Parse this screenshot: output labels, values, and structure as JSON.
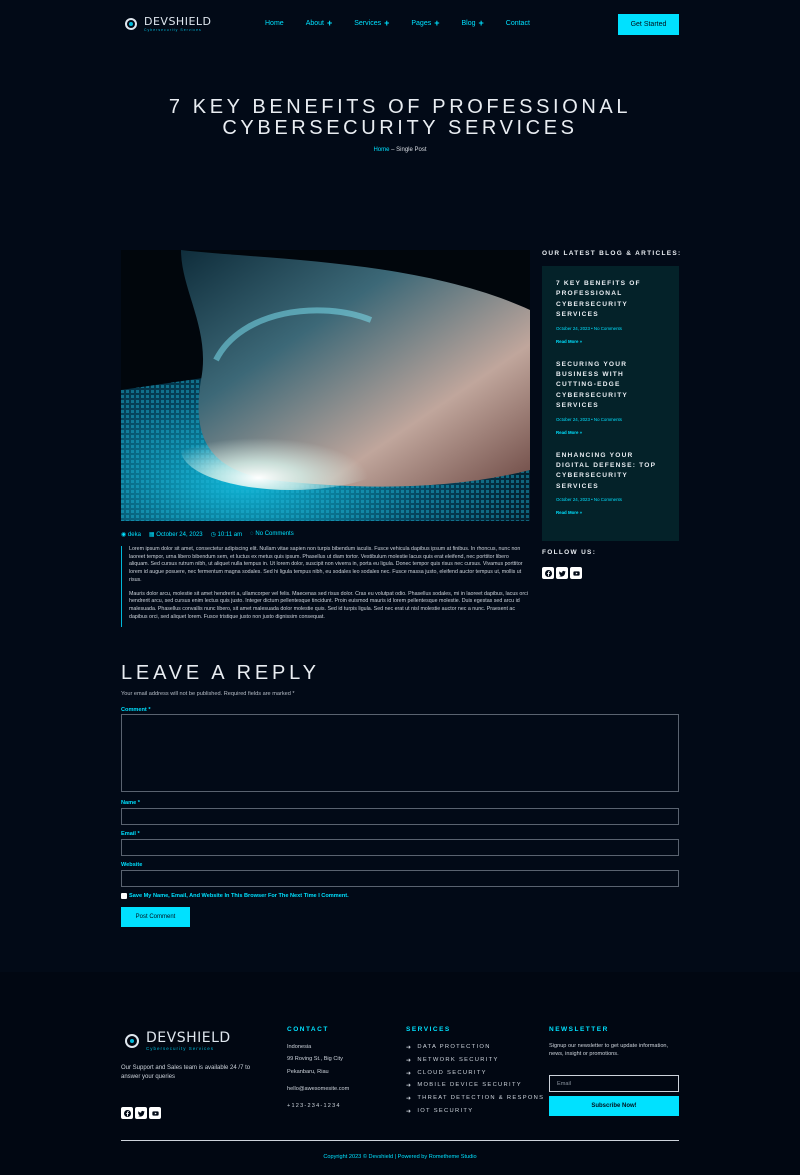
{
  "header": {
    "logo_text": "DEVSHIELD",
    "logo_sub": "Cybersecurity Services",
    "menu": [
      {
        "label": "Home",
        "plus": ""
      },
      {
        "label": "About",
        "plus": "+"
      },
      {
        "label": "Services",
        "plus": "+"
      },
      {
        "label": "Pages",
        "plus": "+"
      },
      {
        "label": "Blog",
        "plus": "+"
      },
      {
        "label": "Contact",
        "plus": ""
      }
    ],
    "cta": "Get Started"
  },
  "hero": {
    "title_line1": "7 KEY BENEFITS OF PROFESSIONAL",
    "title_line2": "CYBERSECURITY SERVICES",
    "crumb_home": "Home",
    "crumb_sep": " – ",
    "crumb_current": "Single Post"
  },
  "post": {
    "author": "deka",
    "date": "October 24, 2023",
    "time": "10:11 am",
    "comments": "No Comments",
    "paragraph1": "Lorem ipsum dolor sit amet, consectetur adipiscing elit. Nullam vitae sapien non turpis bibendum iaculis. Fusce vehicula dapibus ipsum at finibus. In rhoncus, nunc non laoreet tempor, urna libero bibendum sem, et luctus ex metus quis ipsum. Phasellus ut diam tortor. Vestibulum molestie lacus quis erat eleifend, nec porttitor libero aliquam. Sed cursus rutrum nibh, ut aliquet nulla tempus in. Ut lorem dolor, suscipit non viverra in, porta eu ligula. Donec tempor quis risus nec cursus. Vivamus porttitor lorem id augue posuere, nec fermentum magna sodales. Sed hi ligula tempus nibh, eu sodales leo sodales nec. Fusce massa justo, eleifend auctor tempus ut, mollis ut risus.",
    "paragraph2": "Mauris dolor arcu, molestie sit amet hendrerit a, ullamcorper vel felis. Maecenas sed risus dolor. Cras eu volutpat odio. Phasellus sodales, mi in laoreet dapibus, lacus orci hendrerit arcu, sed cursus enim lectus quis justo. Integer dictum pellentesque tincidunt. Proin euismod mauris id lorem pellentesque molestie. Duis egestas sed arcu id malesuada. Phasellus convallis nunc libero, sit amet malesuada dolor molestie quis. Sed id turpis ligula. Sed nec erat ut nisl molestie auctor nec a nunc. Praesent ac dapibus orci, sed aliquet lorem. Fusce tristique justo non justo dignissim consequat."
  },
  "sidebar": {
    "heading": "OUR LATEST BLOG & ARTICLES:",
    "posts": [
      {
        "title": "7 KEY BENEFITS OF PROFESSIONAL CYBERSECURITY SERVICES",
        "meta": "October 24, 2023 • No Comments",
        "more": "Read More »"
      },
      {
        "title": "SECURING YOUR BUSINESS WITH CUTTING-EDGE CYBERSECURITY SERVICES",
        "meta": "October 24, 2023 • No Comments",
        "more": "Read More »"
      },
      {
        "title": "ENHANCING YOUR DIGITAL DEFENSE: TOP CYBERSECURITY SERVICES",
        "meta": "October 24, 2023 • No Comments",
        "more": "Read More »"
      }
    ],
    "follow": "FOLLOW US:"
  },
  "reply": {
    "title": "LEAVE A REPLY",
    "note": "Your email address will not be published. Required fields are marked *",
    "comment_label": "Comment *",
    "name_label": "Name *",
    "email_label": "Email *",
    "website_label": "Website",
    "save_label": "Save My Name, Email, And Website In This Browser For The Next Time I Comment.",
    "submit": "Post Comment"
  },
  "footer": {
    "logo_text": "DEVSHIELD",
    "logo_sub": "Cybersecurity Services",
    "about": "Our Support and Sales team is available 24 /7 to answer your queries",
    "contact_heading": "CONTACT",
    "contact_country": "Indonesia",
    "contact_street": "99 Roving St., Big City",
    "contact_city": "Pekanbaru, Riau",
    "contact_email": "hello@awesomesite.com",
    "contact_phone": "+123-234-1234",
    "services_heading": "SERVICES",
    "services": [
      "DATA PROTECTION",
      "NETWORK SECURITY",
      "CLOUD SECURITY",
      "MOBILE DEVICE SECURITY",
      "THREAT DETECTION & RESPONS",
      "IOT SECURITY"
    ],
    "newsletter_heading": "NEWSLETTER",
    "newsletter_text": "Signup our newsletter to get update information, news, insight or promotions.",
    "email_placeholder": "Email",
    "subscribe": "Subscribe Now!",
    "copyright": "Copyright 2023 © Devshield | Powered by Rometheme Studio"
  }
}
